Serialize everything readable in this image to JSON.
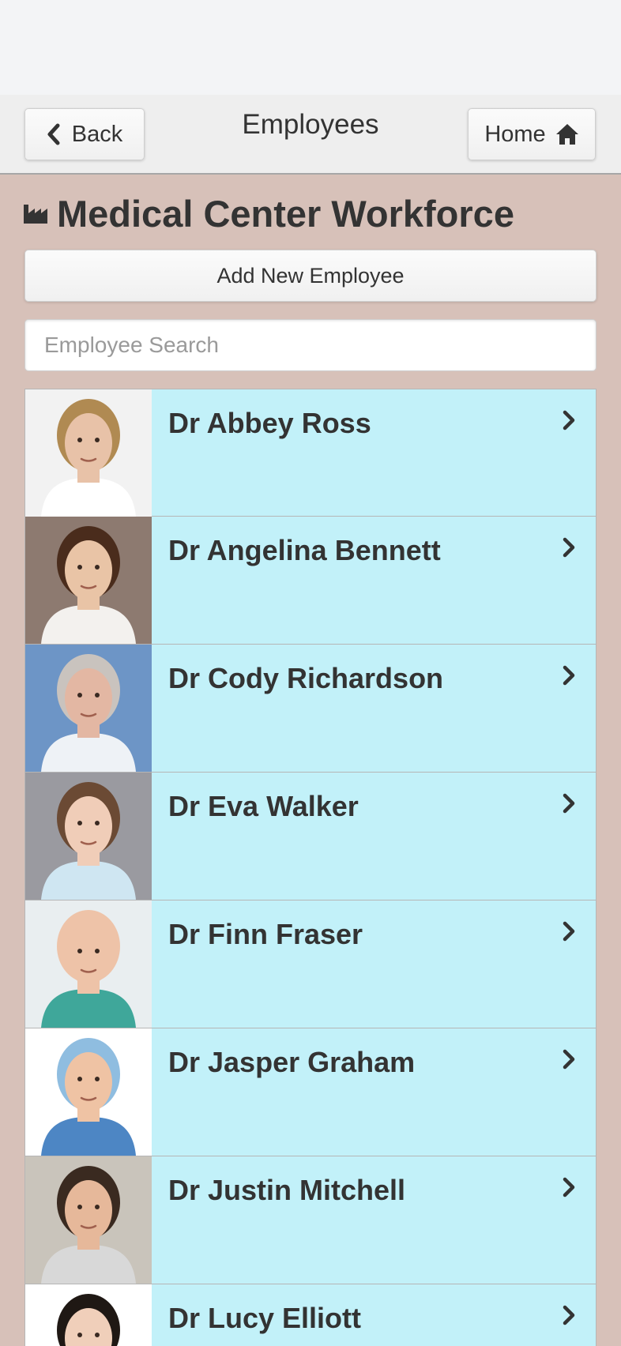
{
  "header": {
    "title": "Employees",
    "back_label": "Back",
    "home_label": "Home"
  },
  "page": {
    "title": "Medical Center Workforce",
    "add_button_label": "Add New Employee",
    "search_placeholder": "Employee Search"
  },
  "employees": [
    {
      "name": "Dr Abbey Ross",
      "photo": {
        "bg": "#f2f2f2",
        "skin": "#e8c2a8",
        "hair": "#b08a52",
        "top": "#ffffff"
      }
    },
    {
      "name": "Dr Angelina Bennett",
      "photo": {
        "bg": "#8d7a70",
        "skin": "#e9c4a6",
        "hair": "#4a2c1c",
        "top": "#f3f1ee"
      }
    },
    {
      "name": "Dr Cody Richardson",
      "photo": {
        "bg": "#6d95c6",
        "skin": "#e3b7a3",
        "hair": "#c9c3be",
        "top": "#eef2f6"
      }
    },
    {
      "name": "Dr Eva Walker",
      "photo": {
        "bg": "#9a9aa0",
        "skin": "#f0cdb8",
        "hair": "#6b4a34",
        "top": "#cfe6f2"
      }
    },
    {
      "name": "Dr Finn Fraser",
      "photo": {
        "bg": "#e9eef0",
        "skin": "#eec3a8",
        "hair": "#eec3a8",
        "top": "#3fa79a"
      }
    },
    {
      "name": "Dr Jasper Graham",
      "photo": {
        "bg": "#ffffff",
        "skin": "#efc3a4",
        "hair": "#8fbde0",
        "top": "#4d86c4"
      }
    },
    {
      "name": "Dr Justin Mitchell",
      "photo": {
        "bg": "#c9c4bb",
        "skin": "#e6b89a",
        "hair": "#3a2a20",
        "top": "#d8d8d8"
      }
    },
    {
      "name": "Dr Lucy Elliott",
      "photo": {
        "bg": "#ffffff",
        "skin": "#f0cfba",
        "hair": "#1f1814",
        "top": "#e0e0e0"
      }
    }
  ],
  "icons": {
    "back": "chevron-left-icon",
    "home": "home-icon",
    "title": "industry-icon",
    "row": "chevron-right-icon"
  }
}
